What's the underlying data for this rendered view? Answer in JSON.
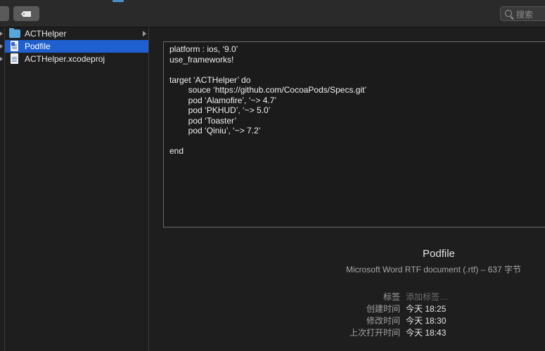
{
  "toolbar": {
    "search": {
      "placeholder": "搜索"
    }
  },
  "files": [
    {
      "name": "ACTHelper",
      "icon": "folder-icon",
      "selected": false,
      "has_children": true
    },
    {
      "name": "Podfile",
      "icon": "rtf-document-icon",
      "selected": true,
      "has_children": false
    },
    {
      "name": "ACTHelper.xcodeproj",
      "icon": "xcodeproj-document-icon",
      "selected": false,
      "has_children": false
    }
  ],
  "preview": {
    "content": "platform : ios, ‘9.0’\nuse_frameworks!\n\ntarget ‘ACTHelper’ do\n        souce ‘https://github.com/CocoaPods/Specs.git’\n        pod ‘Alamofire’, ‘~> 4.7’\n        pod ‘PKHUD’, ‘~> 5.0’\n        pod ‘Toaster’\n        pod ‘Qiniu’, ‘~> 7.2’\n\nend"
  },
  "info": {
    "name": "Podfile",
    "kind": "Microsoft Word RTF document (.rtf) – 637 字节",
    "meta": [
      {
        "label": "标签",
        "value": "添加标签…",
        "placeholder": true
      },
      {
        "label": "创建时间",
        "value": "今天 18:25",
        "placeholder": false
      },
      {
        "label": "修改时间",
        "value": "今天 18:30",
        "placeholder": false
      },
      {
        "label": "上次打开时间",
        "value": "今天 18:43",
        "placeholder": false
      }
    ]
  },
  "colors": {
    "selection": "#1f5fcf",
    "folder": "#57a6dc",
    "background": "#1e1e1e"
  }
}
